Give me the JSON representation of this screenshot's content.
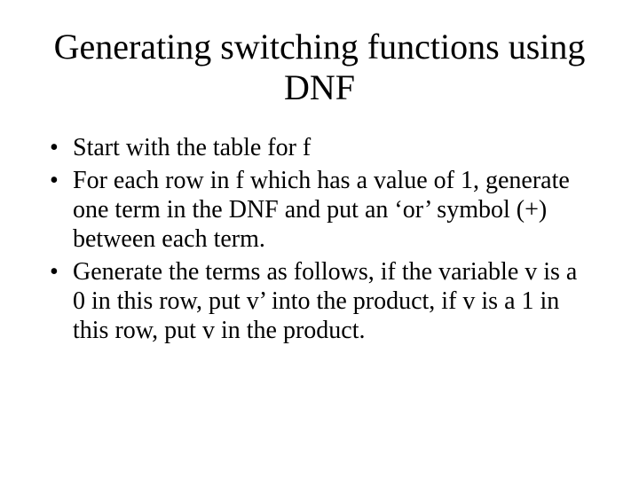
{
  "title": "Generating switching functions using DNF",
  "bullets": [
    "Start with the table for f",
    "For each row in f which has a value of 1, generate one term in the DNF and put an ‘or’ symbol (+) between each term.",
    "Generate the terms as follows, if the variable v is a 0 in this row, put v’ into the product, if v is a 1 in this row, put v in the product."
  ]
}
